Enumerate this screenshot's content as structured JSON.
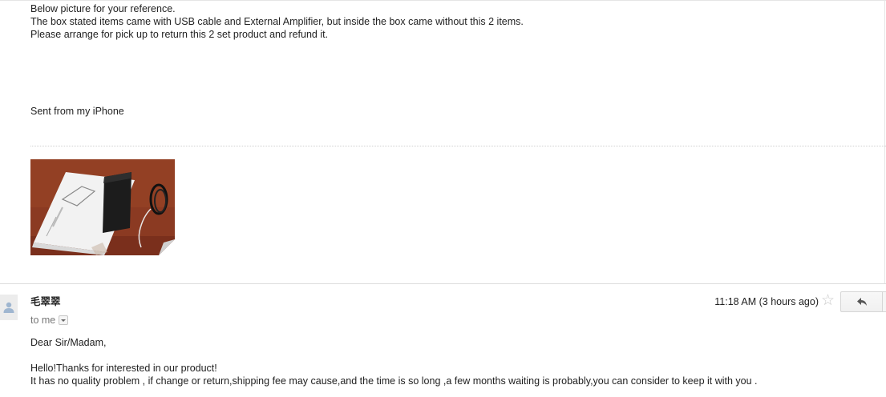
{
  "previous_message": {
    "lines": [
      "Below picture for your reference.",
      "The box stated items came with USB cable and External Amplifier, but inside the box came without this 2 items.",
      "Please arrange for pick up to return this 2 set product and refund it."
    ],
    "signature": "Sent from my iPhone",
    "attachment_icon": "photo-thumbnail"
  },
  "current_message": {
    "sender": "毛翠翠",
    "recipient_label": "to me",
    "timestamp": "11:18 AM (3 hours ago)",
    "star_icon": "star-outline-icon",
    "reply_icon": "reply-arrow-icon",
    "body": {
      "greeting": "Dear Sir/Madam,",
      "line1": "Hello!Thanks for interested in our product!",
      "line2": "It has no quality problem , if change or return,shipping fee may cause,and the time is so long ,a few months waiting is probably,you can consider to keep it with you ."
    }
  },
  "colors": {
    "text": "#222222",
    "muted": "#777777",
    "star": "#c8c8c8"
  }
}
